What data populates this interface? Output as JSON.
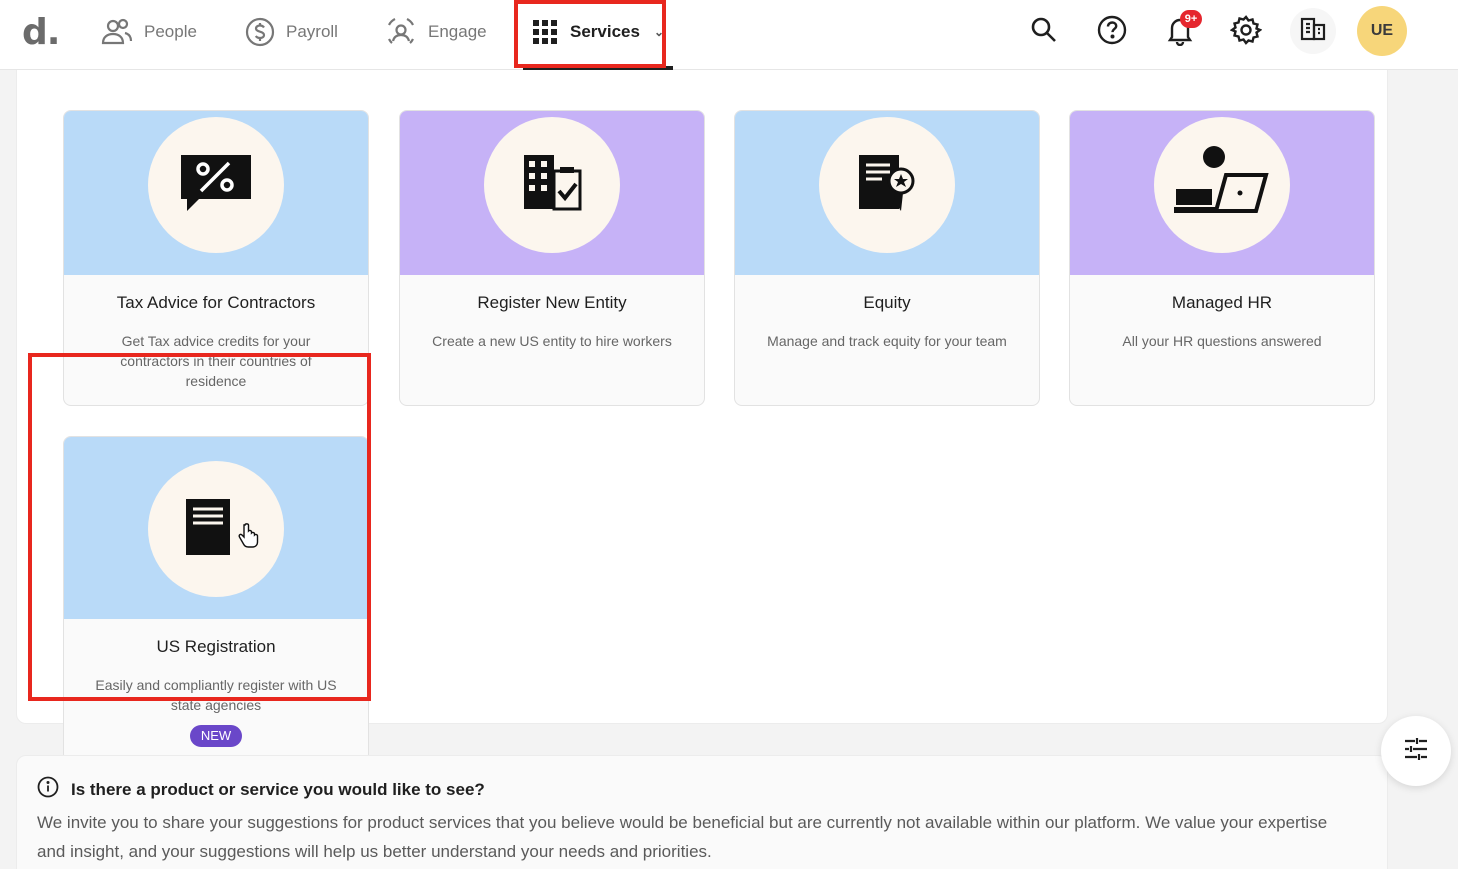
{
  "brand": {
    "logo_text": "d."
  },
  "nav": {
    "people": "People",
    "payroll": "Payroll",
    "engage": "Engage",
    "services": "Services"
  },
  "header_icons": {
    "search": "search-icon",
    "help": "help-icon",
    "notifications": "bell-icon",
    "notification_badge": "9+",
    "settings": "gear-icon",
    "company": "building-icon"
  },
  "user": {
    "initials": "UE"
  },
  "cards": [
    {
      "title": "Tax Advice for Contractors",
      "description": "Get Tax advice credits for your contractors in their countries of residence",
      "icon": "percent-chat-icon"
    },
    {
      "title": "Register New Entity",
      "description": "Create a new US entity to hire workers",
      "icon": "building-check-icon"
    },
    {
      "title": "Equity",
      "description": "Manage and track equity for your team",
      "icon": "certificate-icon"
    },
    {
      "title": "Managed HR",
      "description": "All your HR questions answered",
      "icon": "person-laptop-icon"
    },
    {
      "title": "US Registration",
      "description": "Easily and compliantly register with US state agencies",
      "badge": "NEW",
      "icon": "document-icon"
    }
  ],
  "suggestion": {
    "title": "Is there a product or service you would like to see?",
    "body": "We invite you to share your suggestions for product services that you believe would be beneficial but are currently not available within our platform. We value your expertise and insight, and your suggestions will help us better understand your needs and priorities."
  },
  "colors": {
    "hero_blue": "#b9daf8",
    "hero_purple": "#c6b2f7",
    "badge_new": "#6a47c9",
    "highlight": "#e8271e",
    "avatar": "#f7d67a"
  }
}
